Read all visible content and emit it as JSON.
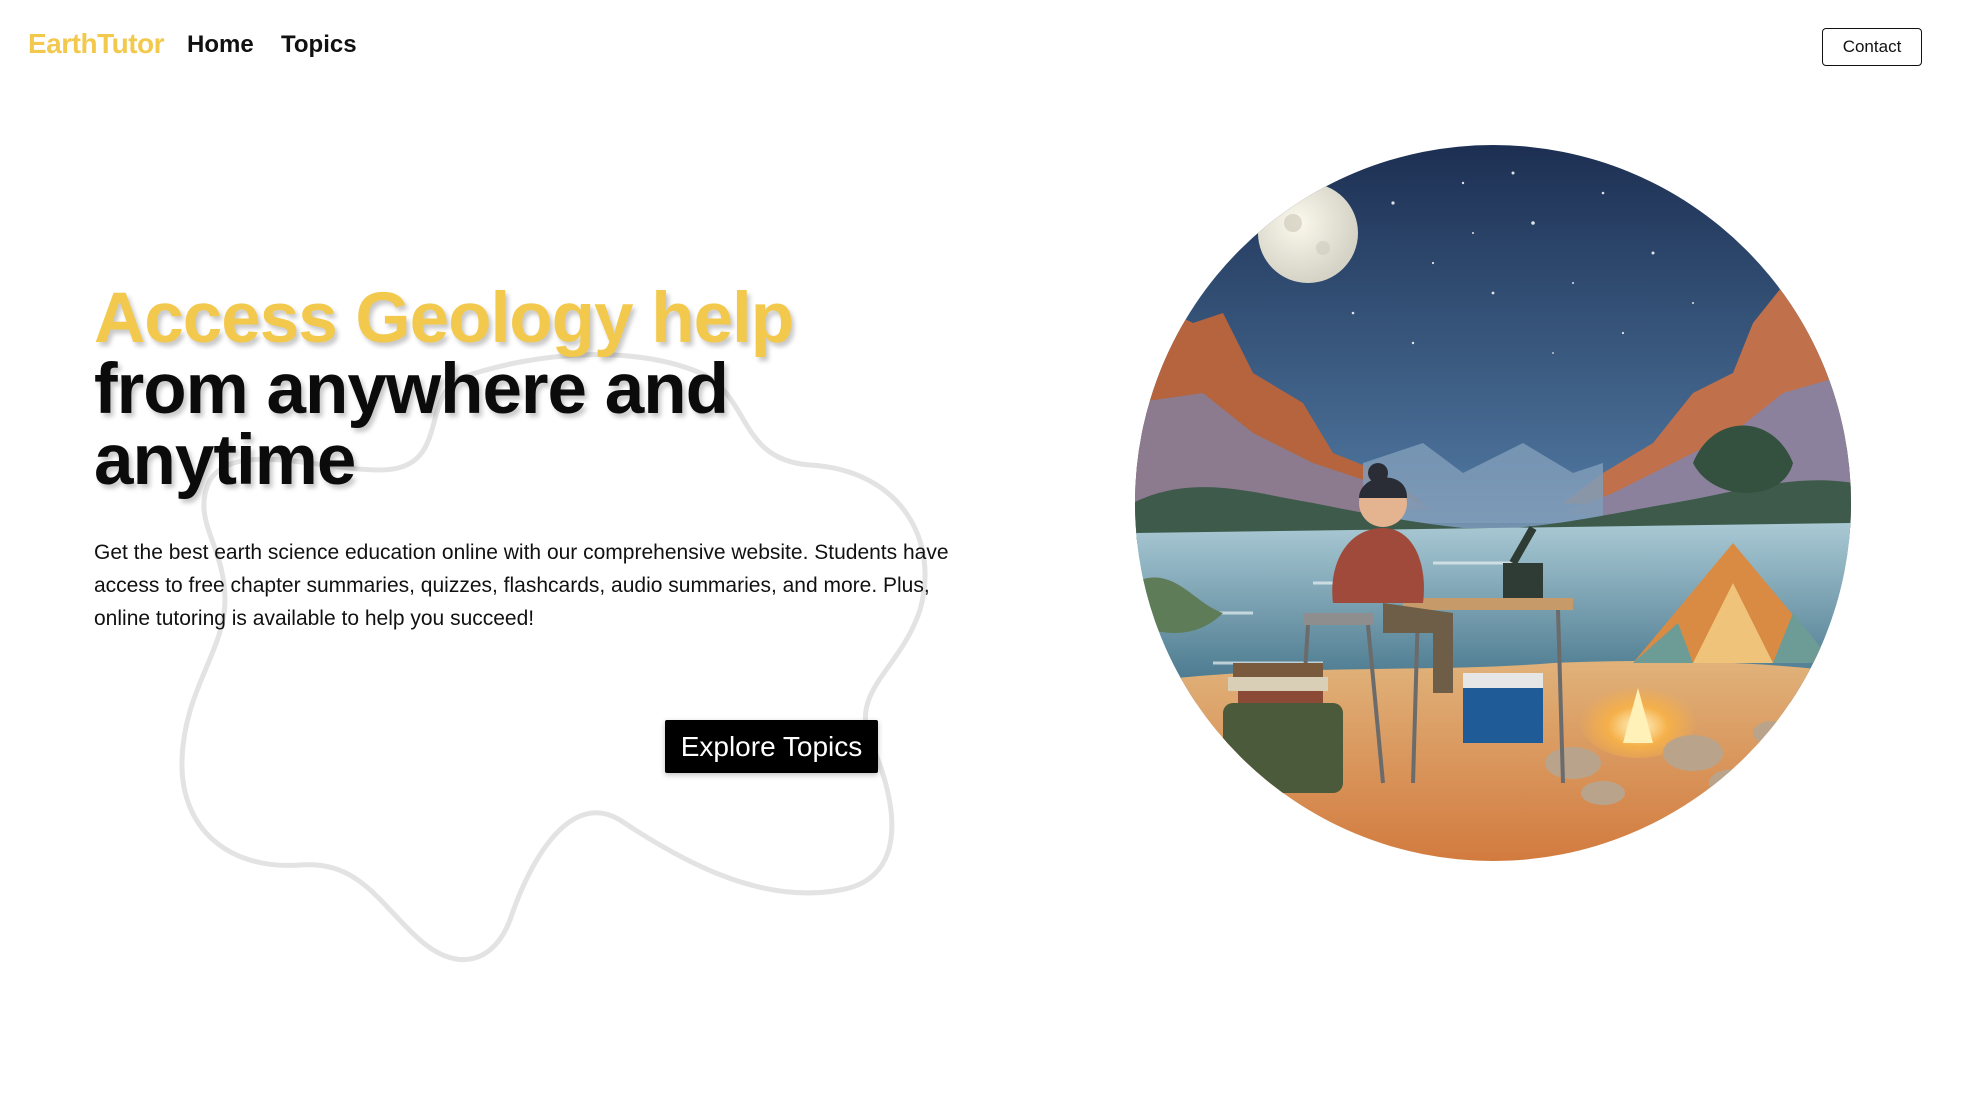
{
  "brand": {
    "name": "EarthTutor",
    "accent_color": "#f2c94c"
  },
  "nav": {
    "links": [
      {
        "label": "Home"
      },
      {
        "label": "Topics"
      }
    ],
    "contact_label": "Contact"
  },
  "hero": {
    "title_accent": "Access Geology help",
    "title_rest": "from anywhere and anytime",
    "description": "Get the best earth science education online with our comprehensive website. Students have access to free chapter summaries, quizzes, flashcards, audio summaries, and more. Plus, online tutoring is available to help you succeed!",
    "cta_label": "Explore Topics"
  },
  "illustration": {
    "icon": "watercolor-geologist-camp-illustration"
  }
}
